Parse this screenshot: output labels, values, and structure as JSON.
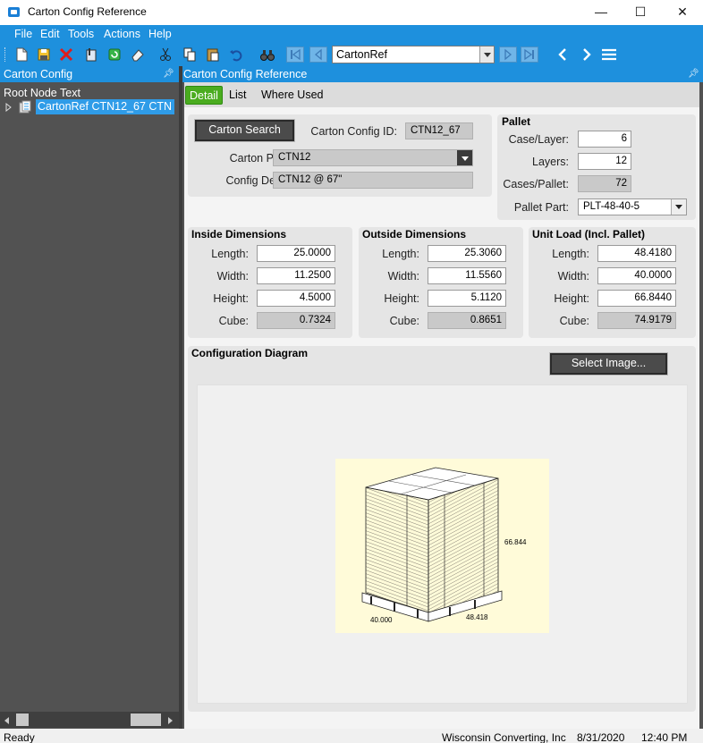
{
  "window": {
    "title": "Carton Config Reference",
    "minimize": "—",
    "maximize": "☐",
    "close": "✕"
  },
  "menu": [
    "File",
    "Edit",
    "Tools",
    "Actions",
    "Help"
  ],
  "toolbar": {
    "nav_value": "CartonRef"
  },
  "tree": {
    "panel_title": "Carton Config",
    "root_text": "Root Node Text",
    "node_label": "CartonRef CTN12_67 CTN"
  },
  "main": {
    "panel_title": "Carton Config Reference",
    "tabs": [
      "Detail",
      "List",
      "Where Used"
    ],
    "carton_search_button": "Carton Search",
    "config_id_label": "Carton Config ID:",
    "config_id_value": "CTN12_67",
    "carton_part_label": "Carton Part:",
    "carton_part_value": "CTN12",
    "config_desc_label": "Config Desc:",
    "config_desc_value": "CTN12 @ 67\""
  },
  "pallet": {
    "title": "Pallet",
    "case_layer_label": "Case/Layer:",
    "case_layer_value": "6",
    "layers_label": "Layers:",
    "layers_value": "12",
    "cases_pallet_label": "Cases/Pallet:",
    "cases_pallet_value": "72",
    "pallet_part_label": "Pallet Part:",
    "pallet_part_value": "PLT-48-40-5"
  },
  "dim_labels": {
    "length": "Length:",
    "width": "Width:",
    "height": "Height:",
    "cube": "Cube:"
  },
  "inside": {
    "title": "Inside Dimensions",
    "length": "25.0000",
    "width": "11.2500",
    "height": "4.5000",
    "cube": "0.7324"
  },
  "outside": {
    "title": "Outside Dimensions",
    "length": "25.3060",
    "width": "11.5560",
    "height": "5.1120",
    "cube": "0.8651"
  },
  "unitload": {
    "title": "Unit Load (Incl. Pallet)",
    "length": "48.4180",
    "width": "40.0000",
    "height": "66.8440",
    "cube": "74.9179"
  },
  "diagram": {
    "title": "Configuration Diagram",
    "select_button": "Select Image...",
    "height_label": "66.844",
    "width_label": "40.000",
    "length_label": "48.418"
  },
  "status": {
    "left": "Ready",
    "company": "Wisconsin Converting, Inc",
    "date": "8/31/2020",
    "time": "12:40 PM"
  },
  "colors": {
    "accent": "#1e90dd",
    "tab_active": "#4aac1f",
    "panel_dark": "#525252",
    "diagram_bg": "#fffbd9"
  }
}
